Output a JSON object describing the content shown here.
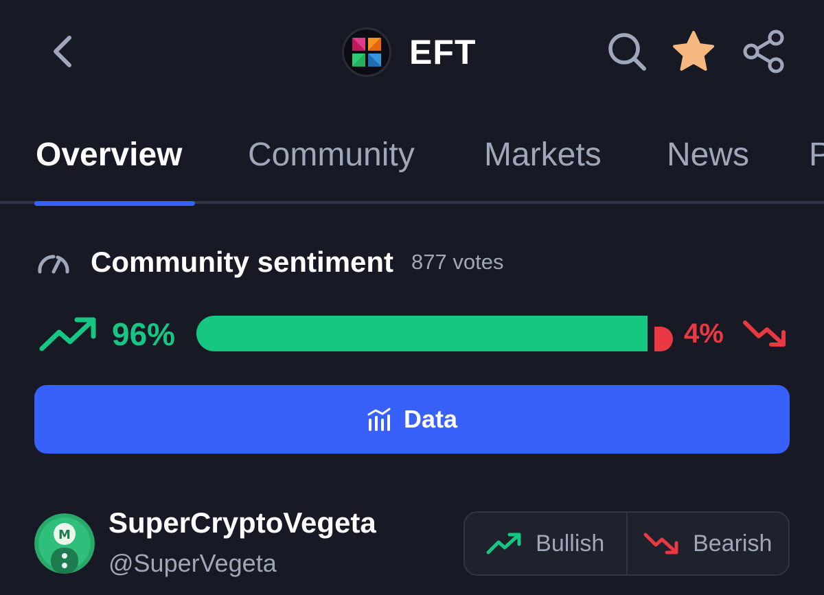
{
  "header": {
    "title": "EFT",
    "icons": {
      "back": "chevron-left-icon",
      "logo": "eft-coin-logo",
      "search": "search-icon",
      "star": "star-icon",
      "share": "share-icon"
    }
  },
  "tabs": [
    {
      "label": "Overview",
      "active": true
    },
    {
      "label": "Community",
      "active": false
    },
    {
      "label": "Markets",
      "active": false
    },
    {
      "label": "News",
      "active": false
    },
    {
      "label": "P",
      "active": false
    }
  ],
  "sentiment": {
    "title": "Community sentiment",
    "votes": "877 votes",
    "bullish_percent_label": "96%",
    "bearish_percent_label": "4%",
    "bullish_fraction": 0.96,
    "bearish_fraction": 0.04
  },
  "data_button": {
    "label": "Data"
  },
  "post": {
    "author_name": "SuperCryptoVegeta",
    "author_handle": "@SuperVegeta",
    "bullish_label": "Bullish",
    "bearish_label": "Bearish"
  },
  "colors": {
    "background": "#171924",
    "accent": "#3861fb",
    "bullish": "#16c784",
    "bearish": "#ea3943",
    "star": "#f6b87e",
    "muted_text": "#a1a7bb"
  }
}
